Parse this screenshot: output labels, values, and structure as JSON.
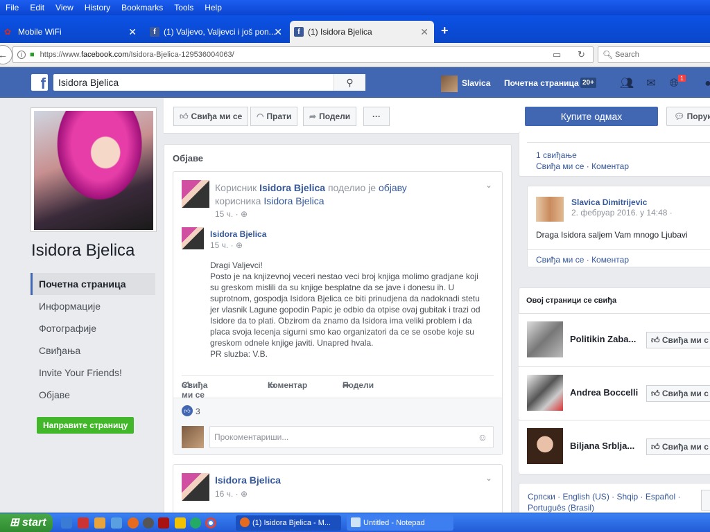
{
  "browser": {
    "menu": [
      "File",
      "Edit",
      "View",
      "History",
      "Bookmarks",
      "Tools",
      "Help"
    ],
    "tabs": [
      {
        "title": "Mobile WiFi",
        "icon": "huawei-icon"
      },
      {
        "title": "(1) Valjevo, Valjevci i još pon...",
        "icon": "facebook-icon"
      },
      {
        "title": "(1) Isidora Bjelica",
        "icon": "facebook-icon",
        "active": true
      }
    ],
    "url_prefix": "https://www.",
    "url_domain": "facebook.com",
    "url_path": "/Isidora-Bjelica-129536004063/",
    "search_placeholder": "Search"
  },
  "fb": {
    "search_value": "Isidora Bjelica",
    "user_name": "Slavica",
    "home_label": "Почетна страница",
    "home_count": "20+",
    "notif_badge": "1",
    "brand_color": "#4267b2"
  },
  "page": {
    "name": "Isidora Bjelica",
    "nav": [
      "Почетна страница",
      "Информације",
      "Фотографије",
      "Свиђања",
      "Invite Your Friends!",
      "Објаве"
    ],
    "create_page": "Направите страницу",
    "actions": {
      "like": "Свиђа ми се",
      "follow": "Прати",
      "share": "Подели",
      "more": "···"
    },
    "buy_now": "Купите одмах",
    "message": "Порук"
  },
  "posts": {
    "title": "Објаве",
    "p1": {
      "prefix": "Корисник ",
      "author": "Isidora Bjelica",
      "mid": " поделио је ",
      "link": "објаву",
      "line2_prefix": "корисника ",
      "line2_author": "Isidora Bjelica",
      "time": "15 ч. ·",
      "inner_author": "Isidora Bjelica",
      "inner_time": "15 ч. ·",
      "body": [
        "Dragi Valjevci!",
        "Posto je na knjizevnoj veceri nestao veci broj knjiga molimo gradjane koji",
        "su greskom mislili da su knjige besplatne da se jave i donesu ih. U",
        "suprotnom, gospodja Isidora Bjelica ce biti prinudjena da nadoknadi stetu",
        "jer vlasnik Lagune gopodin Papic je odbio da otpise ovaj gubitak i trazi od",
        "Isidore da to plati. Obzirom da znamo da Isidora ima veliki problem i da",
        "placa svoja lecenja sigurni smo kao organizatori da ce se osobe koje su",
        "greskom odnele knjige javiti. Unapred hvala.",
        "PR sluzba: V.B."
      ],
      "like": "Свиђа ми се",
      "comment": "Коментар",
      "share": "Подели",
      "likes_count": "3",
      "comment_placeholder": "Прокоментариши..."
    },
    "p2": {
      "author": "Isidora Bjelica",
      "time": "16 ч. ·"
    }
  },
  "right": {
    "c1_likes": "1 свиђање",
    "c1_like": "Свиђа ми се",
    "c1_comment": "Коментар",
    "c2_author": "Slavica Dimitrijevic",
    "c2_time": "2. фебруар 2016. у 14:48 ·",
    "c2_text": "Draga Isidora saljem Vam mnogo Ljubavi",
    "c2_like": "Свиђа ми се",
    "c2_comment": "Коментар",
    "likes_title": "Овој страници се свиђа",
    "liked_pages": [
      {
        "name": "Politikin Zaba...",
        "button": "Свиђа ми с"
      },
      {
        "name": "Andrea Boccelli",
        "button": "Свиђа ми с"
      },
      {
        "name": "Biljana Srblja...",
        "button": "Свиђа ми с"
      }
    ],
    "languages_line1": "Српски · English (US) · Shqip · Español ·",
    "languages_line2": "Português (Brasil)"
  },
  "taskbar": {
    "start": "start",
    "tasks": [
      "(1) Isidora Bjelica - M...",
      "Untitled - Notepad"
    ]
  }
}
